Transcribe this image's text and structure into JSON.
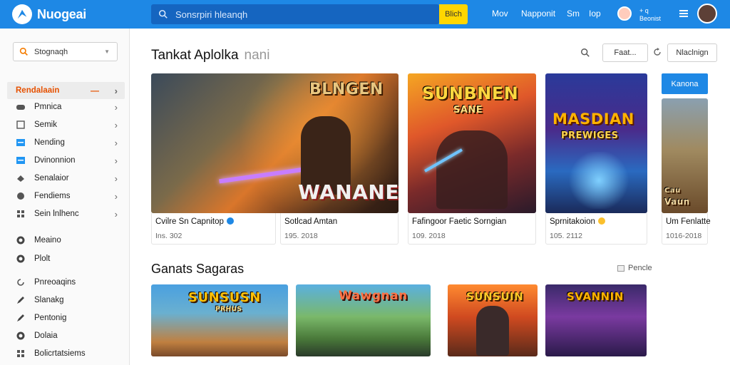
{
  "header": {
    "brand": "Nuogeai",
    "search_placeholder": "Sonsrpiri hleanqh",
    "search_button": "Blich",
    "links": [
      "Mov",
      "Napponit",
      "Sm",
      "Iop"
    ],
    "account_text_line1": "+ q",
    "account_text_line2": "Beonist"
  },
  "sidebar": {
    "search_value": "Stognaqh",
    "items": [
      {
        "label": "Rendalaain",
        "active": true,
        "icon": "none"
      },
      {
        "label": "Pmnica",
        "icon": "gamepad-icon"
      },
      {
        "label": "Semik",
        "icon": "box-icon"
      },
      {
        "label": "Nending",
        "icon": "window-icon"
      },
      {
        "label": "Dvinonnion",
        "icon": "window-icon"
      },
      {
        "label": "Senalaior",
        "icon": "puzzle-icon"
      },
      {
        "label": "Fendiems",
        "icon": "chat-icon"
      },
      {
        "label": "Sein lnlhenc",
        "icon": "grid-icon"
      },
      {
        "label": "Meaino",
        "icon": "globe-icon"
      },
      {
        "label": "Plolt",
        "icon": "globe-icon"
      },
      {
        "label": "Pnreoaqins",
        "icon": "refresh-icon"
      },
      {
        "label": "Slanakg",
        "icon": "pen-icon"
      },
      {
        "label": "Pentonig",
        "icon": "pen-icon"
      },
      {
        "label": "Dolaia",
        "icon": "globe-icon"
      },
      {
        "label": "Bolicrtatsiems",
        "icon": "grid-icon"
      }
    ]
  },
  "section1": {
    "title": "Tankat Aplolka",
    "title_suffix": "nani",
    "filter_button": "Faat...",
    "right_button": "Nlaclnign",
    "side_badge": "Kanona",
    "cards": [
      {
        "title": "Cvilre Sn Capnitop",
        "date": "Ins. 302",
        "art_text": "BLNGEN",
        "art_text2": "WANANEN",
        "verified": "blue"
      },
      {
        "title": "Sotlcad Amtan",
        "date": "195. 2018",
        "art_text": "",
        "art_text2": "",
        "verified": "none"
      },
      {
        "title": "Fafingoor Faetic Sorngian",
        "date": "109. 2018",
        "art_text": "SUNBNEN",
        "art_text2": "SANE",
        "verified": "none"
      },
      {
        "title": "Sprnitakoion",
        "date": "105. 2112",
        "art_text": "MASDIAN",
        "art_text2": "PREWIGES",
        "verified": "yellow"
      },
      {
        "title": "Um Fenlatte",
        "date": "1016-2018",
        "art_text": "Cau",
        "art_text2": "Vaun",
        "verified": "none"
      }
    ]
  },
  "section2": {
    "title": "Ganats Sagaras",
    "link": "Pencle",
    "cards": [
      {
        "art_text": "SUNSUSN",
        "art_text2": "PRHUS"
      },
      {
        "art_text": "Wawgnan",
        "art_text2": ""
      },
      {
        "art_text": "SUNSUIN",
        "art_text2": ""
      },
      {
        "art_text": "SVANNIN",
        "art_text2": ""
      }
    ]
  },
  "colors": {
    "topbar": "#1e88e5",
    "search_bg": "#1565c0",
    "search_button": "#ffd600",
    "active_text": "#e65100"
  }
}
